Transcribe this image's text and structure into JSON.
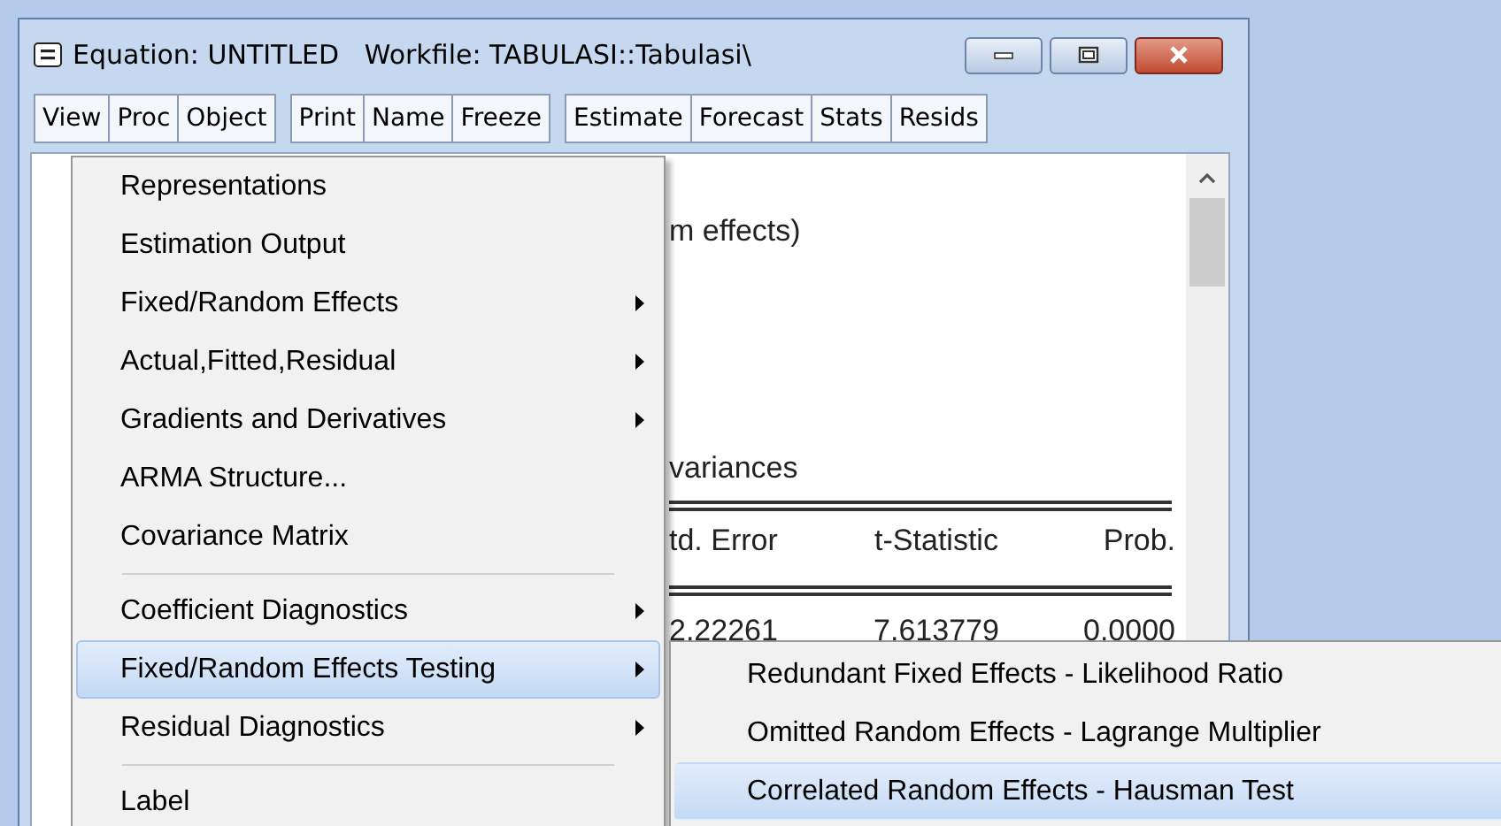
{
  "window": {
    "title": "Equation: UNTITLED   Workfile: TABULASI::Tabulasi\\"
  },
  "toolbar": {
    "groups": [
      [
        "View",
        "Proc",
        "Object"
      ],
      [
        "Print",
        "Name",
        "Freeze"
      ],
      [
        "Estimate",
        "Forecast",
        "Stats",
        "Resids"
      ]
    ]
  },
  "output": {
    "lines": [
      "m effects)",
      "variances"
    ],
    "table": {
      "columns": [
        "td. Error",
        "t-Statistic",
        "Prob."
      ],
      "rows": [
        [
          "2.22261",
          "7.613779",
          "0.0000"
        ]
      ]
    }
  },
  "menu": {
    "items": [
      {
        "kind": "item",
        "label": "Representations",
        "submenu": false,
        "selected": false
      },
      {
        "kind": "item",
        "label": "Estimation Output",
        "submenu": false,
        "selected": false
      },
      {
        "kind": "item",
        "label": "Fixed/Random Effects",
        "submenu": true,
        "selected": false
      },
      {
        "kind": "item",
        "label": "Actual,Fitted,Residual",
        "submenu": true,
        "selected": false
      },
      {
        "kind": "item",
        "label": "Gradients and Derivatives",
        "submenu": true,
        "selected": false
      },
      {
        "kind": "item",
        "label": "ARMA Structure...",
        "submenu": false,
        "selected": false
      },
      {
        "kind": "item",
        "label": "Covariance Matrix",
        "submenu": false,
        "selected": false
      },
      {
        "kind": "separator"
      },
      {
        "kind": "item",
        "label": "Coefficient Diagnostics",
        "submenu": true,
        "selected": false
      },
      {
        "kind": "item",
        "label": "Fixed/Random Effects Testing",
        "submenu": true,
        "selected": true
      },
      {
        "kind": "item",
        "label": "Residual Diagnostics",
        "submenu": true,
        "selected": false
      },
      {
        "kind": "separator"
      },
      {
        "kind": "item",
        "label": "Label",
        "submenu": false,
        "selected": false
      }
    ]
  },
  "submenu": {
    "items": [
      {
        "label": "Redundant Fixed Effects - Likelihood Ratio",
        "selected": false
      },
      {
        "label": "Omitted Random Effects - Lagrange Multiplier",
        "selected": false
      },
      {
        "label": "Correlated Random Effects - Hausman Test",
        "selected": true
      }
    ]
  }
}
